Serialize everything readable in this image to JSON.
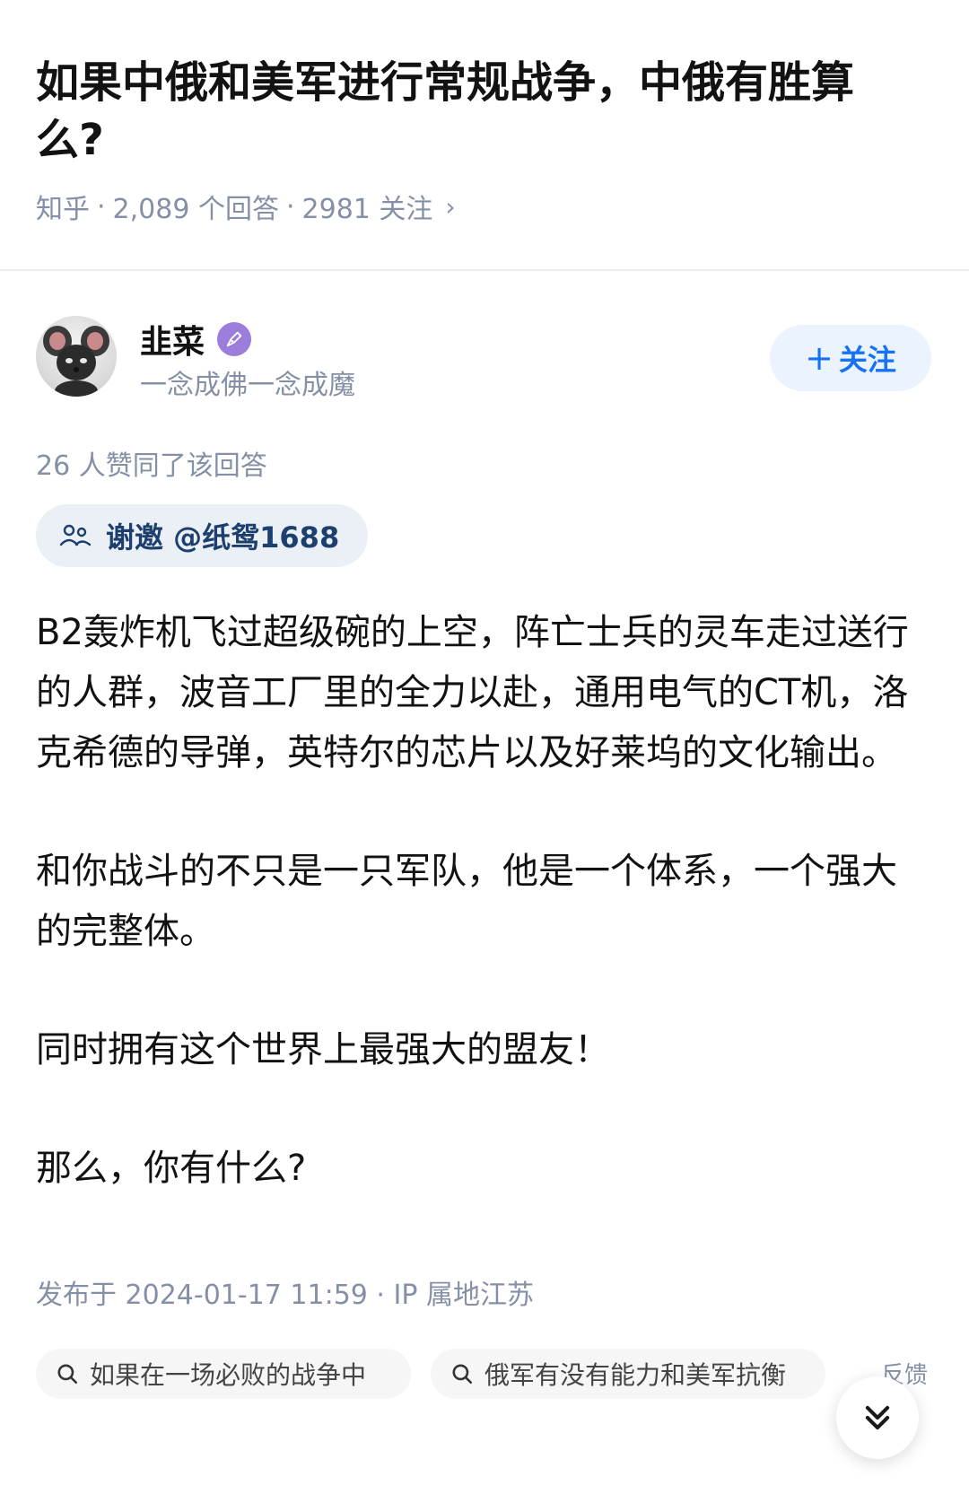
{
  "question": {
    "title": "如果中俄和美军进行常规战争，中俄有胜算么?",
    "source": "知乎",
    "answers_count": "2,089 个回答",
    "follows_count": "2981 关注",
    "separator": "·"
  },
  "author": {
    "name": "韭菜",
    "bio": "一念成佛一念成魔",
    "avatar_icon": "mouse-avatar",
    "badge_icon": "pen-badge-icon",
    "follow_label": "关注",
    "follow_plus": "+"
  },
  "upvote_info": "26 人赞同了该回答",
  "invite": {
    "label": "谢邀 @纸鸳1688",
    "icon": "people-icon"
  },
  "answer": {
    "paragraphs": [
      "B2轰炸机飞过超级碗的上空，阵亡士兵的灵车走过送行的人群，波音工厂里的全力以赴，通用电气的CT机，洛克希德的导弹，英特尔的芯片以及好莱坞的文化输出。",
      "和你战斗的不只是一只军队，他是一个体系，一个强大的完整体。",
      "同时拥有这个世界上最强大的盟友！",
      "那么，你有什么?"
    ]
  },
  "publish_info": "发布于 2024-01-17 11:59 · IP 属地江苏",
  "related_searches": [
    "如果在一场必败的战争中",
    "俄军有没有能力和美军抗衡"
  ],
  "feedback_label": "反馈",
  "colors": {
    "accent": "#1772f6",
    "meta_gray": "#8590a6",
    "badge_purple": "#9b7ddb"
  }
}
